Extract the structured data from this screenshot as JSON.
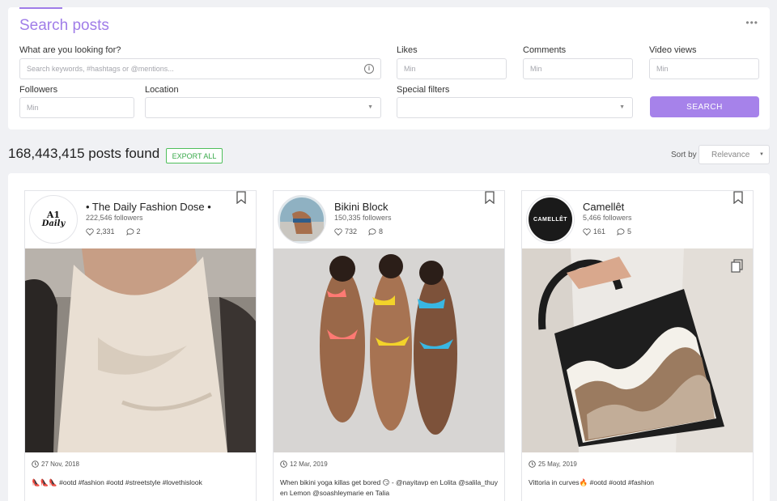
{
  "search": {
    "title": "Search posts",
    "more_label": "•••",
    "query_label": "What are you looking for?",
    "query_placeholder": "Search keywords, #hashtags or @mentions...",
    "likes_label": "Likes",
    "likes_placeholder": "Min",
    "comments_label": "Comments",
    "comments_placeholder": "Min",
    "views_label": "Video views",
    "views_placeholder": "Min",
    "followers_label": "Followers",
    "followers_placeholder": "Min",
    "location_label": "Location",
    "special_label": "Special filters",
    "button_label": "SEARCH"
  },
  "results": {
    "count_text": "168,443,415 posts found",
    "export_label": "EXPORT ALL",
    "sort_label": "Sort by",
    "sort_value": "Relevance"
  },
  "cards": [
    {
      "name": "• The Daily Fashion Dose •",
      "followers": "222,546 followers",
      "likes": "2,331",
      "comments": "2",
      "date": "27 Nov, 2018",
      "caption": "👠👠👠 #ootd #fashion #ootd #streetstyle #lovethislook",
      "avatar_text_1": "A1",
      "avatar_text_2": "Daily"
    },
    {
      "name": "Bikini Block",
      "followers": "150,335 followers",
      "likes": "732",
      "comments": "8",
      "date": "12 Mar, 2019",
      "caption": "When bikini yoga killas get bored 😏 - @nayitavp en Lolita @salila_thuy en Lemon @soashleymarie en Talia"
    },
    {
      "name": "Camellêt",
      "followers": "5,466 followers",
      "likes": "161",
      "comments": "5",
      "date": "25 May, 2019",
      "caption": "Vittoria in curves🔥 #ootd #ootd #fashion",
      "avatar_text": "CAMELLÊT"
    }
  ],
  "colors": {
    "accent": "#a682ea",
    "export_green": "#38a94a",
    "background": "#f0f1f4"
  }
}
